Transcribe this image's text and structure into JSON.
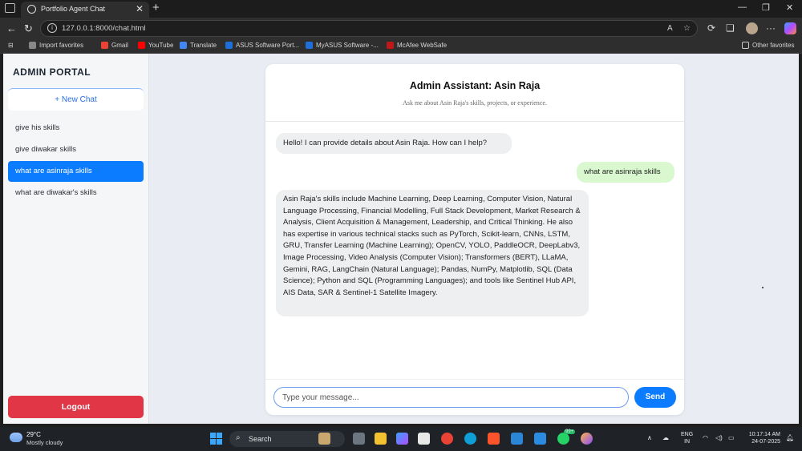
{
  "browser": {
    "tab_title": "Portfolio Agent Chat",
    "tab_close": "✕",
    "new_tab": "+",
    "url": "127.0.0.1:8000/chat.html",
    "more": "···",
    "bookmarks": [
      {
        "label": "Import favorites",
        "color": "#888888"
      },
      {
        "label": "Gmail",
        "color": "#ea4335"
      },
      {
        "label": "YouTube",
        "color": "#ff0000"
      },
      {
        "label": "Translate",
        "color": "#4285f4"
      },
      {
        "label": "ASUS Software Port...",
        "color": "#1e6fd9"
      },
      {
        "label": "MyASUS Software -...",
        "color": "#1e6fd9"
      },
      {
        "label": "McAfee WebSafe",
        "color": "#c01818"
      }
    ],
    "other_favorites": "Other favorites"
  },
  "sidebar": {
    "title": "ADMIN PORTAL",
    "new_chat": "+ New Chat",
    "items": [
      {
        "label": "give his skills",
        "active": false
      },
      {
        "label": "give diwakar skills",
        "active": false
      },
      {
        "label": "what are asinraja skills",
        "active": true
      },
      {
        "label": "what are diwakar's skills",
        "active": false
      }
    ],
    "logout": "Logout"
  },
  "chat": {
    "title": "Admin Assistant: Asin Raja",
    "subtitle": "Ask me about Asin Raja's skills, projects, or experience.",
    "messages": [
      {
        "role": "bot",
        "text": "Hello! I can provide details about Asin Raja. How can I help?"
      },
      {
        "role": "user",
        "text": "what are asinraja skills"
      },
      {
        "role": "bot",
        "text": "Asin Raja's skills include Machine Learning, Deep Learning, Computer Vision, Natural Language Processing, Financial Modelling, Full Stack Development, Market Research & Analysis, Client Acquisition & Management, Leadership, and Critical Thinking. He also has expertise in various technical stacks such as PyTorch, Scikit-learn, CNNs, LSTM, GRU, Transfer Learning (Machine Learning); OpenCV, YOLO, PaddleOCR, DeepLabv3, Image Processing, Video Analysis (Computer Vision); Transformers (BERT), LLaMA, Gemini, RAG, LangChain (Natural Language); Pandas, NumPy, Matplotlib, SQL (Data Science); Python and SQL (Programming Languages); and tools like Sentinel Hub API, AIS Data, SAR & Sentinel-1 Satellite Imagery."
      }
    ],
    "input_placeholder": "Type your message...",
    "send": "Send"
  },
  "taskbar": {
    "temperature": "29°C",
    "condition": "Mostly cloudy",
    "search": "Search",
    "lang_line1": "ENG",
    "lang_line2": "IN",
    "time": "10:17:14 AM",
    "date": "24-07-2025",
    "notification_count": "99+"
  }
}
